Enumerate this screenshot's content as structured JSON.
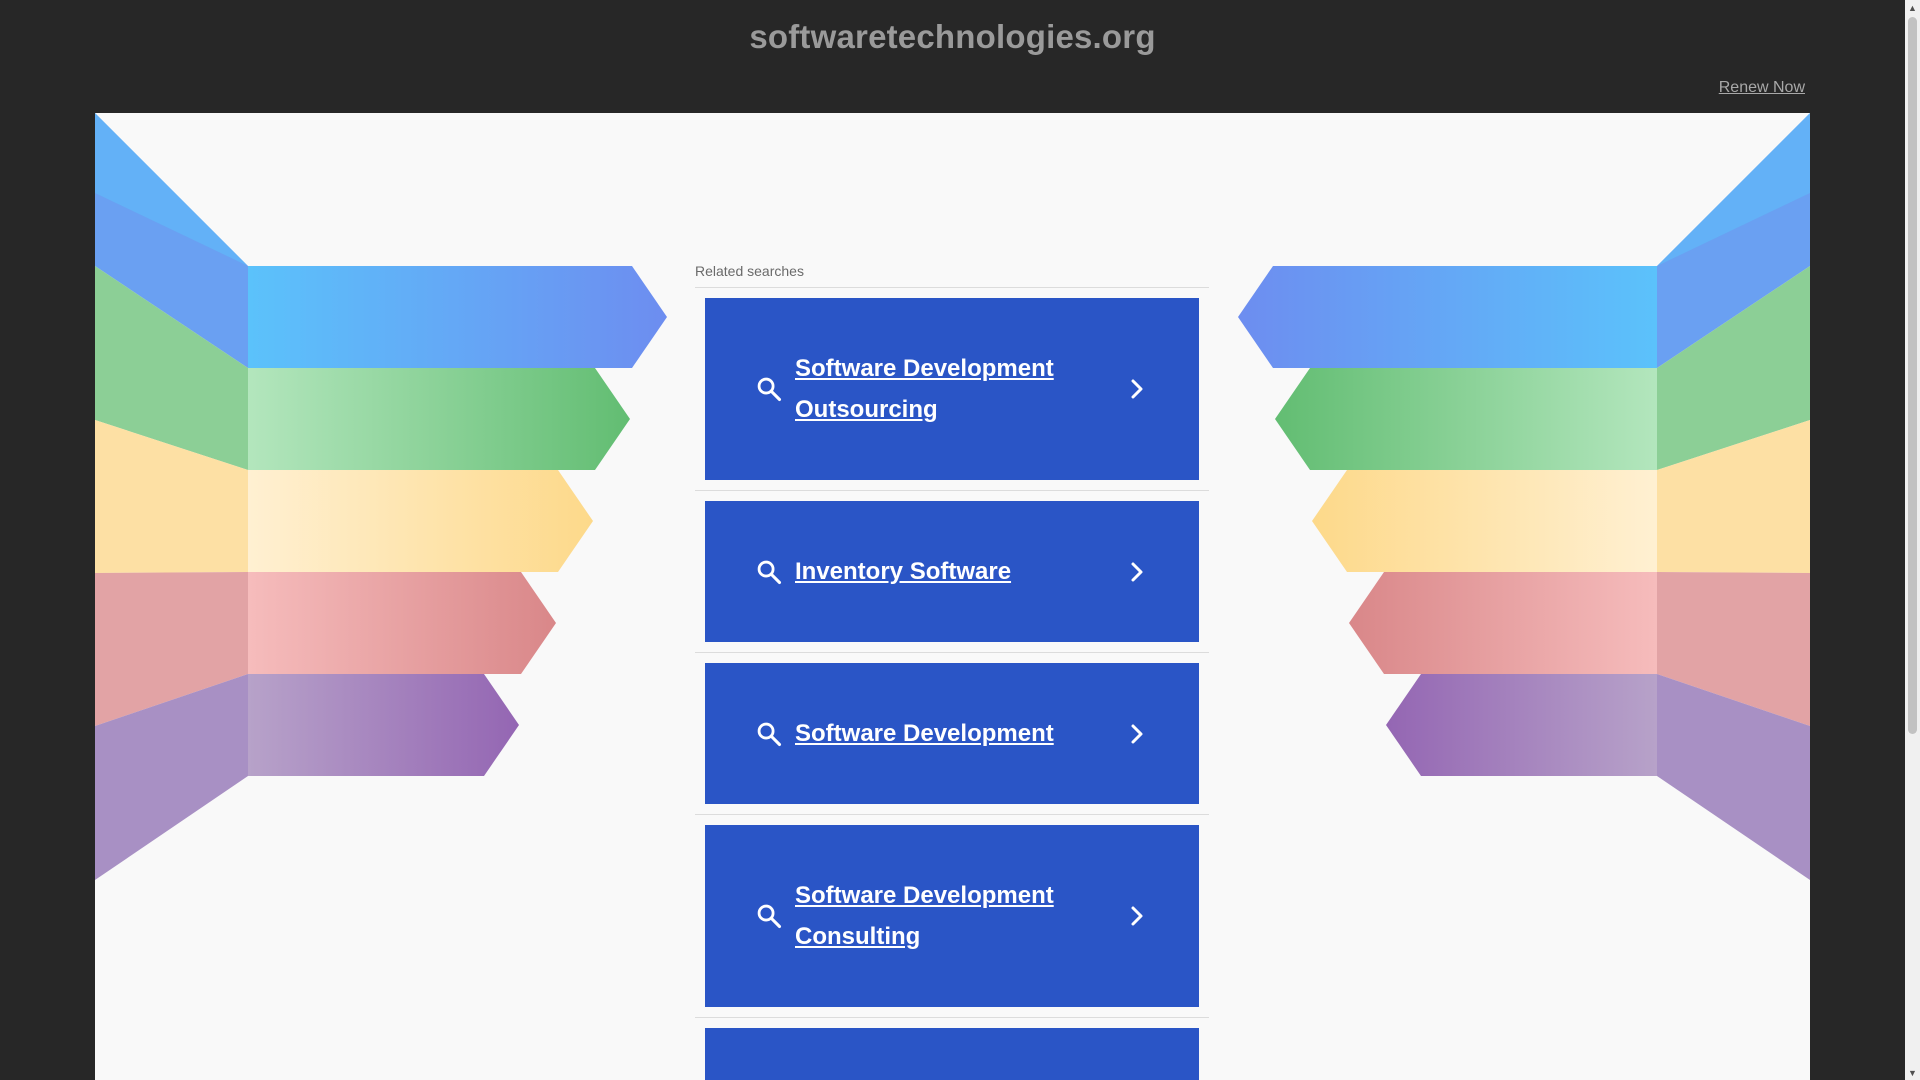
{
  "header": {
    "domain": "softwaretechnologies.org",
    "renew_label": "Renew Now"
  },
  "related": {
    "label": "Related searches",
    "items": [
      {
        "line1": "Software Development",
        "line2": "Outsourcing"
      },
      {
        "line1": "Inventory Software",
        "line2": ""
      },
      {
        "line1": "Software Development",
        "line2": ""
      },
      {
        "line1": "Software Development",
        "line2": "Consulting"
      }
    ]
  },
  "icons": {
    "search": "search-icon",
    "chevron": "chevron-right-icon"
  },
  "colors": {
    "background": "#272727",
    "panel": "#f9f9f9",
    "result": "#2a55c6",
    "blue": "#5fb3f7",
    "green": "#6cc27a",
    "yellow": "#fde3a0",
    "pink": "#e39696",
    "purple": "#9b72b8"
  }
}
